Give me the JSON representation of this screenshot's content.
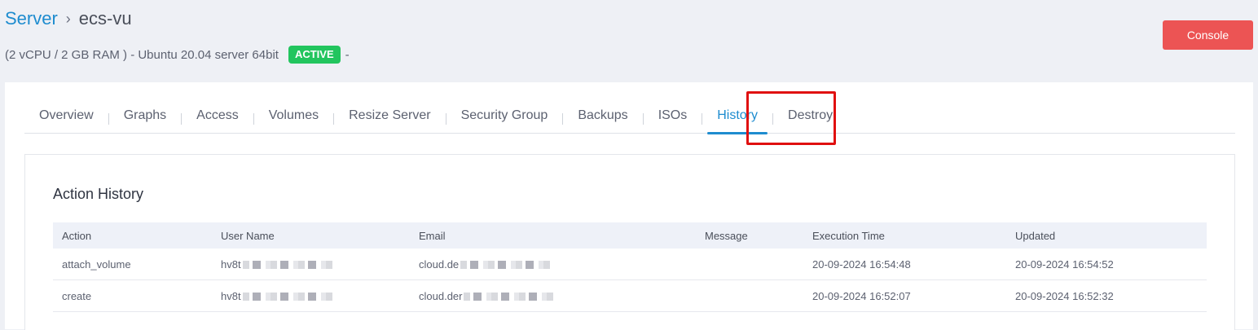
{
  "breadcrumb": {
    "parent": "Server",
    "separator": "›",
    "current": "ecs-vu"
  },
  "server": {
    "specs": "(2 vCPU / 2 GB RAM ) - Ubuntu 20.04 server 64bit",
    "status": "ACTIVE",
    "trailing": "-"
  },
  "console_label": "Console",
  "tabs": [
    {
      "label": "Overview"
    },
    {
      "label": "Graphs"
    },
    {
      "label": "Access"
    },
    {
      "label": "Volumes"
    },
    {
      "label": "Resize Server"
    },
    {
      "label": "Security Group"
    },
    {
      "label": "Backups"
    },
    {
      "label": "ISOs"
    },
    {
      "label": "History",
      "active": true
    },
    {
      "label": "Destroy"
    }
  ],
  "panel_title": "Action History",
  "table": {
    "headers": [
      "Action",
      "User Name",
      "Email",
      "Message",
      "Execution Time",
      "Updated"
    ],
    "rows": [
      {
        "action": "attach_volume",
        "user": "hv8t",
        "email": "cloud.de",
        "message": "",
        "executed": "20-09-2024 16:54:48",
        "updated": "20-09-2024 16:54:52"
      },
      {
        "action": "create",
        "user": "hv8t",
        "email": "cloud.der",
        "message": "",
        "executed": "20-09-2024 16:52:07",
        "updated": "20-09-2024 16:52:32"
      }
    ]
  },
  "colors": {
    "accent": "#1e8ccf",
    "danger": "#ec5454",
    "success": "#22c55e",
    "highlight": "#e01010"
  }
}
